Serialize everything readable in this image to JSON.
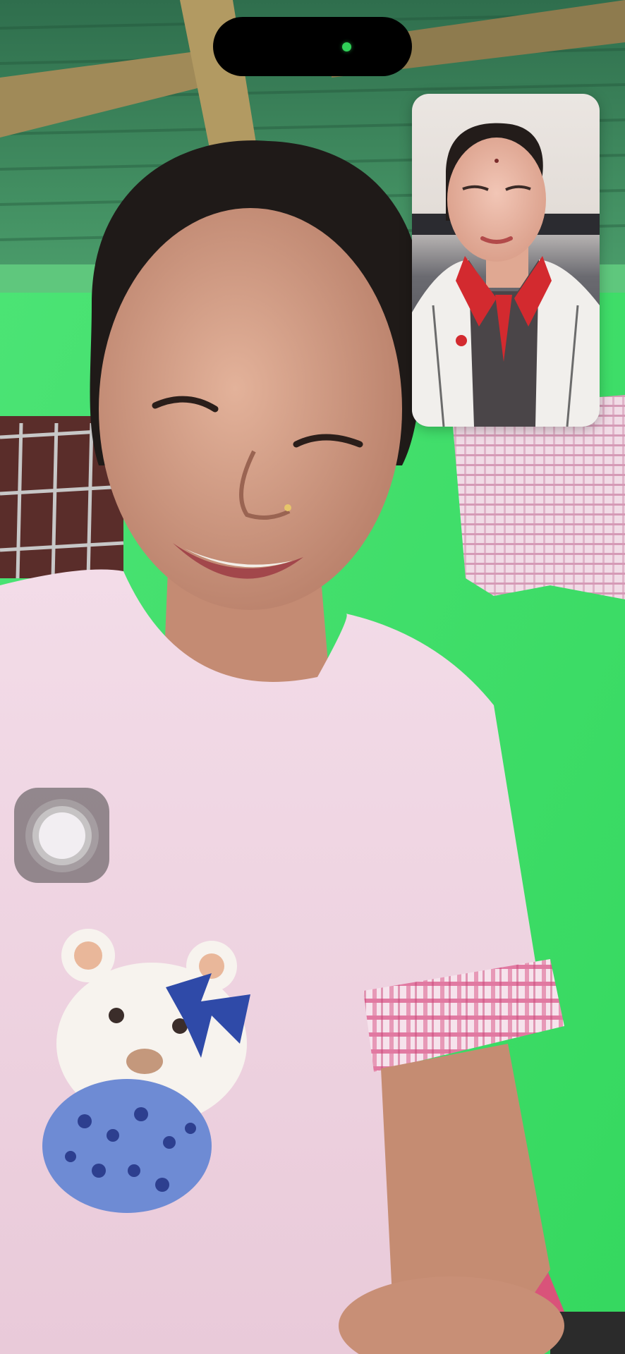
{
  "call": {
    "type": "video-call",
    "camera_active": true,
    "indicator_color": "#30d158"
  },
  "colors": {
    "wall_green": "#43e06a",
    "shirt_pink": "#f0d6e4",
    "roof_green": "#3a8a5a"
  },
  "icons": {
    "assistive_touch": "assistive-touch-icon",
    "camera_indicator": "camera-indicator-icon"
  }
}
